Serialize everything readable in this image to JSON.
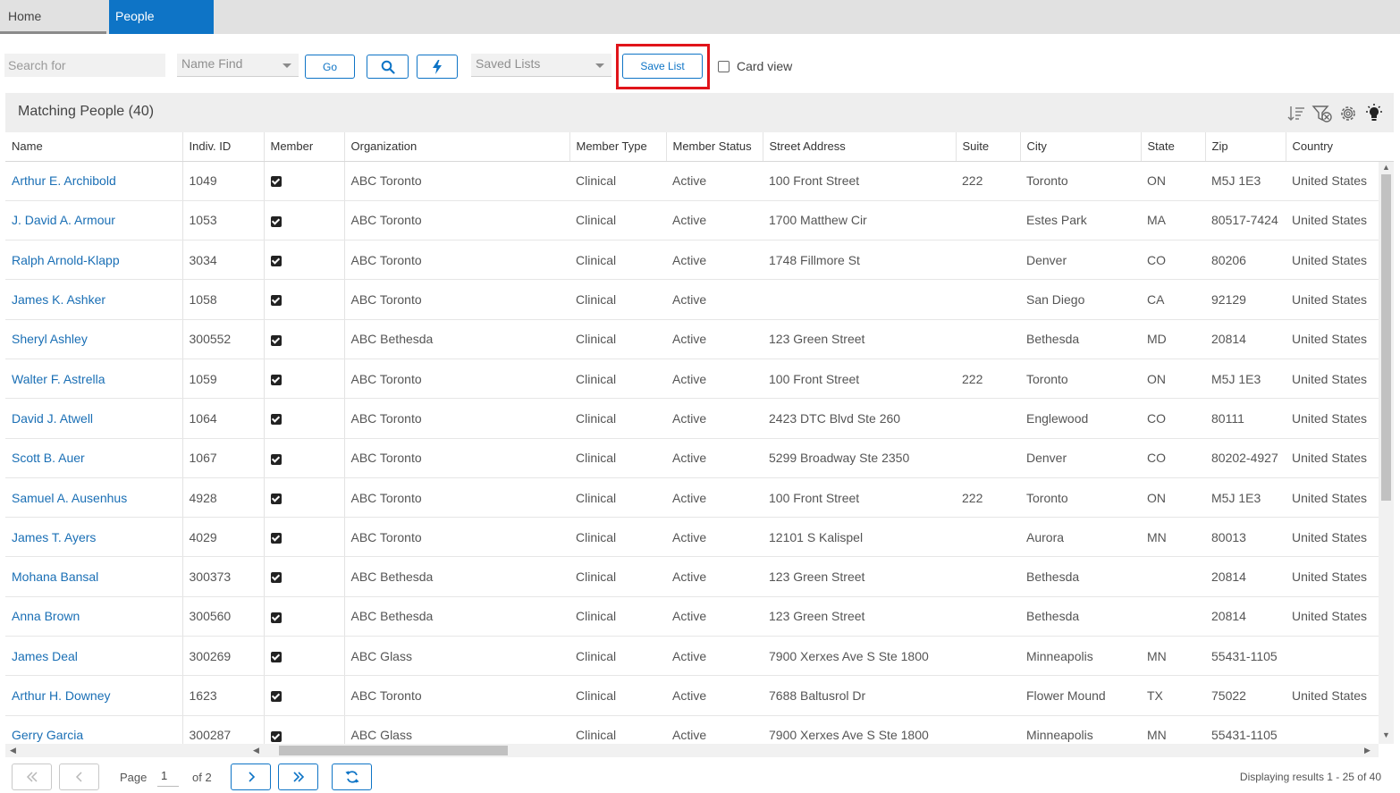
{
  "tabs": [
    {
      "label": "Home",
      "active": false
    },
    {
      "label": "People",
      "active": true
    }
  ],
  "toolbar": {
    "search_placeholder": "Search for",
    "name_find": "Name Find",
    "go_label": "Go",
    "search_icon": "search-icon",
    "quick_icon": "lightning-bolt-icon",
    "saved_lists": "Saved Lists",
    "save_list_label": "Save List",
    "card_view_label": "Card view"
  },
  "panel": {
    "title": "Matching People (40)",
    "icons": [
      "sort-icon",
      "clear-filter-icon",
      "settings-gear-icon",
      "lightbulb-icon"
    ]
  },
  "columns": [
    "Name",
    "Indiv. ID",
    "Member",
    "Organization",
    "Member Type",
    "Member Status",
    "Street Address",
    "Suite",
    "City",
    "State",
    "Zip",
    "Country"
  ],
  "rows": [
    {
      "name": "Arthur E. Archibold",
      "id": "1049",
      "member": true,
      "org": "ABC Toronto",
      "type": "Clinical",
      "status": "Active",
      "street": "100 Front Street",
      "suite": "222",
      "city": "Toronto",
      "state": "ON",
      "zip": "M5J 1E3",
      "country": "United States"
    },
    {
      "name": "J. David A. Armour",
      "id": "1053",
      "member": true,
      "org": "ABC Toronto",
      "type": "Clinical",
      "status": "Active",
      "street": "1700 Matthew Cir",
      "suite": "",
      "city": "Estes Park",
      "state": "MA",
      "zip": "80517-7424",
      "country": "United States"
    },
    {
      "name": "Ralph Arnold-Klapp",
      "id": "3034",
      "member": true,
      "org": "ABC Toronto",
      "type": "Clinical",
      "status": "Active",
      "street": "1748 Fillmore St",
      "suite": "",
      "city": "Denver",
      "state": "CO",
      "zip": "80206",
      "country": "United States"
    },
    {
      "name": "James K. Ashker",
      "id": "1058",
      "member": true,
      "org": "ABC Toronto",
      "type": "Clinical",
      "status": "Active",
      "street": "",
      "suite": "",
      "city": "San Diego",
      "state": "CA",
      "zip": "92129",
      "country": "United States"
    },
    {
      "name": "Sheryl Ashley",
      "id": "300552",
      "member": true,
      "org": "ABC Bethesda",
      "type": "Clinical",
      "status": "Active",
      "street": "123 Green Street",
      "suite": "",
      "city": "Bethesda",
      "state": "MD",
      "zip": "20814",
      "country": "United States"
    },
    {
      "name": "Walter F. Astrella",
      "id": "1059",
      "member": true,
      "org": "ABC Toronto",
      "type": "Clinical",
      "status": "Active",
      "street": "100 Front Street",
      "suite": "222",
      "city": "Toronto",
      "state": "ON",
      "zip": "M5J 1E3",
      "country": "United States"
    },
    {
      "name": "David J. Atwell",
      "id": "1064",
      "member": true,
      "org": "ABC Toronto",
      "type": "Clinical",
      "status": "Active",
      "street": "2423 DTC Blvd Ste 260",
      "suite": "",
      "city": "Englewood",
      "state": "CO",
      "zip": "80111",
      "country": "United States"
    },
    {
      "name": "Scott B. Auer",
      "id": "1067",
      "member": true,
      "org": "ABC Toronto",
      "type": "Clinical",
      "status": "Active",
      "street": "5299 Broadway Ste 2350",
      "suite": "",
      "city": "Denver",
      "state": "CO",
      "zip": "80202-4927",
      "country": "United States"
    },
    {
      "name": "Samuel A. Ausenhus",
      "id": "4928",
      "member": true,
      "org": "ABC Toronto",
      "type": "Clinical",
      "status": "Active",
      "street": "100 Front Street",
      "suite": "222",
      "city": "Toronto",
      "state": "ON",
      "zip": "M5J 1E3",
      "country": "United States"
    },
    {
      "name": "James T. Ayers",
      "id": "4029",
      "member": true,
      "org": "ABC Toronto",
      "type": "Clinical",
      "status": "Active",
      "street": "12101 S Kalispel",
      "suite": "",
      "city": "Aurora",
      "state": "MN",
      "zip": "80013",
      "country": "United States"
    },
    {
      "name": "Mohana Bansal",
      "id": "300373",
      "member": true,
      "org": "ABC Bethesda",
      "type": "Clinical",
      "status": "Active",
      "street": "123 Green Street",
      "suite": "",
      "city": "Bethesda",
      "state": "",
      "zip": "20814",
      "country": "United States"
    },
    {
      "name": "Anna Brown",
      "id": "300560",
      "member": true,
      "org": "ABC Bethesda",
      "type": "Clinical",
      "status": "Active",
      "street": "123 Green Street",
      "suite": "",
      "city": "Bethesda",
      "state": "",
      "zip": "20814",
      "country": "United States"
    },
    {
      "name": "James Deal",
      "id": "300269",
      "member": true,
      "org": "ABC Glass",
      "type": "Clinical",
      "status": "Active",
      "street": "7900 Xerxes Ave S Ste 1800",
      "suite": "",
      "city": "Minneapolis",
      "state": "MN",
      "zip": "55431-1105",
      "country": ""
    },
    {
      "name": "Arthur H. Downey",
      "id": "1623",
      "member": true,
      "org": "ABC Toronto",
      "type": "Clinical",
      "status": "Active",
      "street": "7688 Baltusrol Dr",
      "suite": "",
      "city": "Flower Mound",
      "state": "TX",
      "zip": "75022",
      "country": "United States"
    },
    {
      "name": "Gerry Garcia",
      "id": "300287",
      "member": true,
      "org": "ABC Glass",
      "type": "Clinical",
      "status": "Active",
      "street": "7900 Xerxes Ave S Ste 1800",
      "suite": "",
      "city": "Minneapolis",
      "state": "MN",
      "zip": "55431-1105",
      "country": ""
    }
  ],
  "pager": {
    "page_label": "Page",
    "current_page": "1",
    "of_label": "of 2",
    "results_text": "Displaying results 1 - 25 of 40"
  },
  "colors": {
    "accent": "#0e74c6",
    "highlight": "#e0141a",
    "link": "#1a6fb5"
  }
}
